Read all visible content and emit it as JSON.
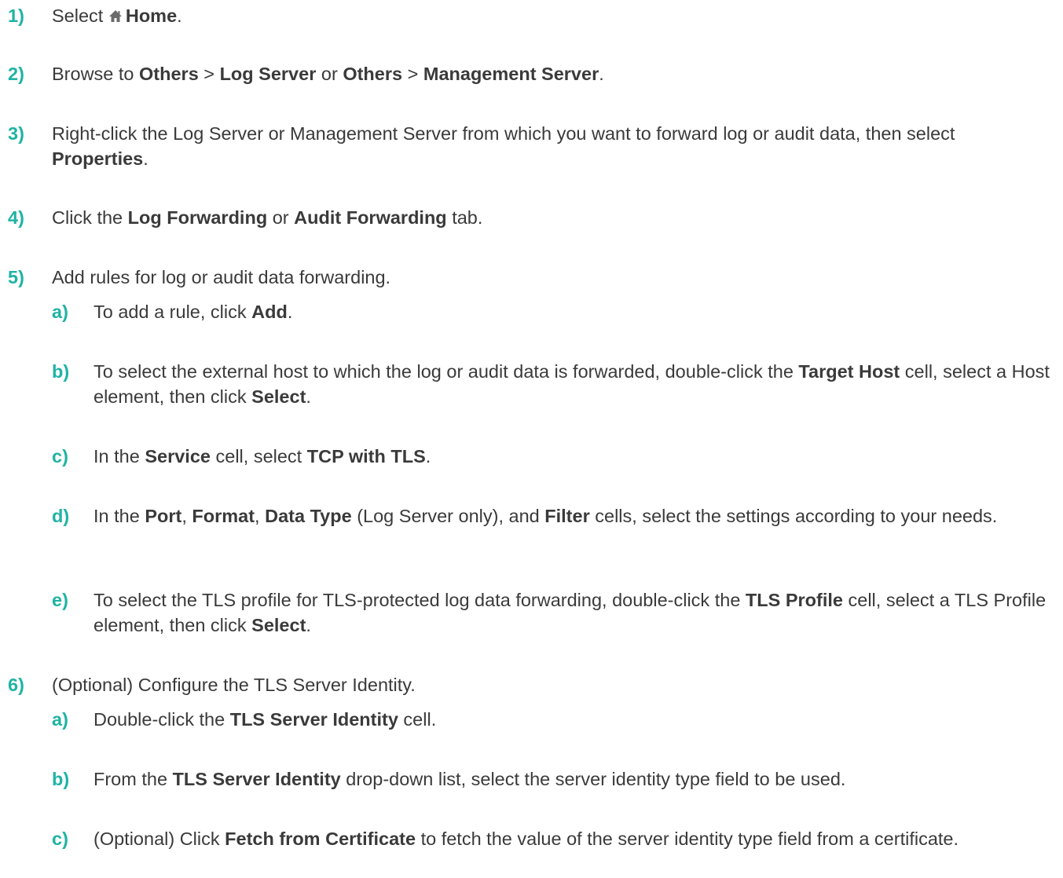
{
  "colors": {
    "step_number": "#1fb3a4",
    "text": "#3a3a3a"
  },
  "icons": {
    "home": "home-icon"
  },
  "steps": {
    "s1": {
      "num": "1)",
      "a": "Select ",
      "b": "Home",
      "c": "."
    },
    "s2": {
      "num": "2)",
      "a": "Browse to ",
      "b": "Others",
      "c": " > ",
      "d": "Log Server",
      "e": " or ",
      "f": "Others",
      "g": " > ",
      "h": "Management Server",
      "i": "."
    },
    "s3": {
      "num": "3)",
      "a": "Right-click the Log Server or Management Server from which you want to forward log or audit data, then select ",
      "b": "Properties",
      "c": "."
    },
    "s4": {
      "num": "4)",
      "a": "Click the ",
      "b": "Log Forwarding",
      "c": " or ",
      "d": "Audit Forwarding",
      "e": " tab."
    },
    "s5": {
      "num": "5)",
      "text": "Add rules for log or audit data forwarding.",
      "a": {
        "num": "a)",
        "a": "To add a rule, click ",
        "b": "Add",
        "c": "."
      },
      "b": {
        "num": "b)",
        "a": "To select the external host to which the log or audit data is forwarded, double-click the ",
        "b": "Target Host",
        "c": " cell, select a Host element, then click ",
        "d": "Select",
        "e": "."
      },
      "c": {
        "num": "c)",
        "a": "In the ",
        "b": "Service",
        "c": " cell, select ",
        "d": "TCP with TLS",
        "e": "."
      },
      "d": {
        "num": "d)",
        "a": "In the ",
        "b": "Port",
        "c": ", ",
        "d": "Format",
        "e": ", ",
        "f": "Data Type",
        "g": " (Log Server only), and ",
        "h": "Filter",
        "i": " cells, select the settings according to your needs."
      },
      "e": {
        "num": "e)",
        "a": "To select the TLS profile for TLS-protected log data forwarding, double-click the ",
        "b": "TLS Profile",
        "c": " cell, select a TLS Profile element, then click ",
        "d": "Select",
        "e": "."
      }
    },
    "s6": {
      "num": "6)",
      "text": "(Optional) Configure the TLS Server Identity.",
      "a": {
        "num": "a)",
        "a": "Double-click the ",
        "b": "TLS Server Identity",
        "c": " cell."
      },
      "b": {
        "num": "b)",
        "a": "From the ",
        "b": "TLS Server Identity",
        "c": " drop-down list, select the server identity type field to be used."
      },
      "c": {
        "num": "c)",
        "a": "(Optional) Click ",
        "b": "Fetch from Certificate",
        "c": " to fetch the value of the server identity type field from a certificate."
      }
    }
  }
}
